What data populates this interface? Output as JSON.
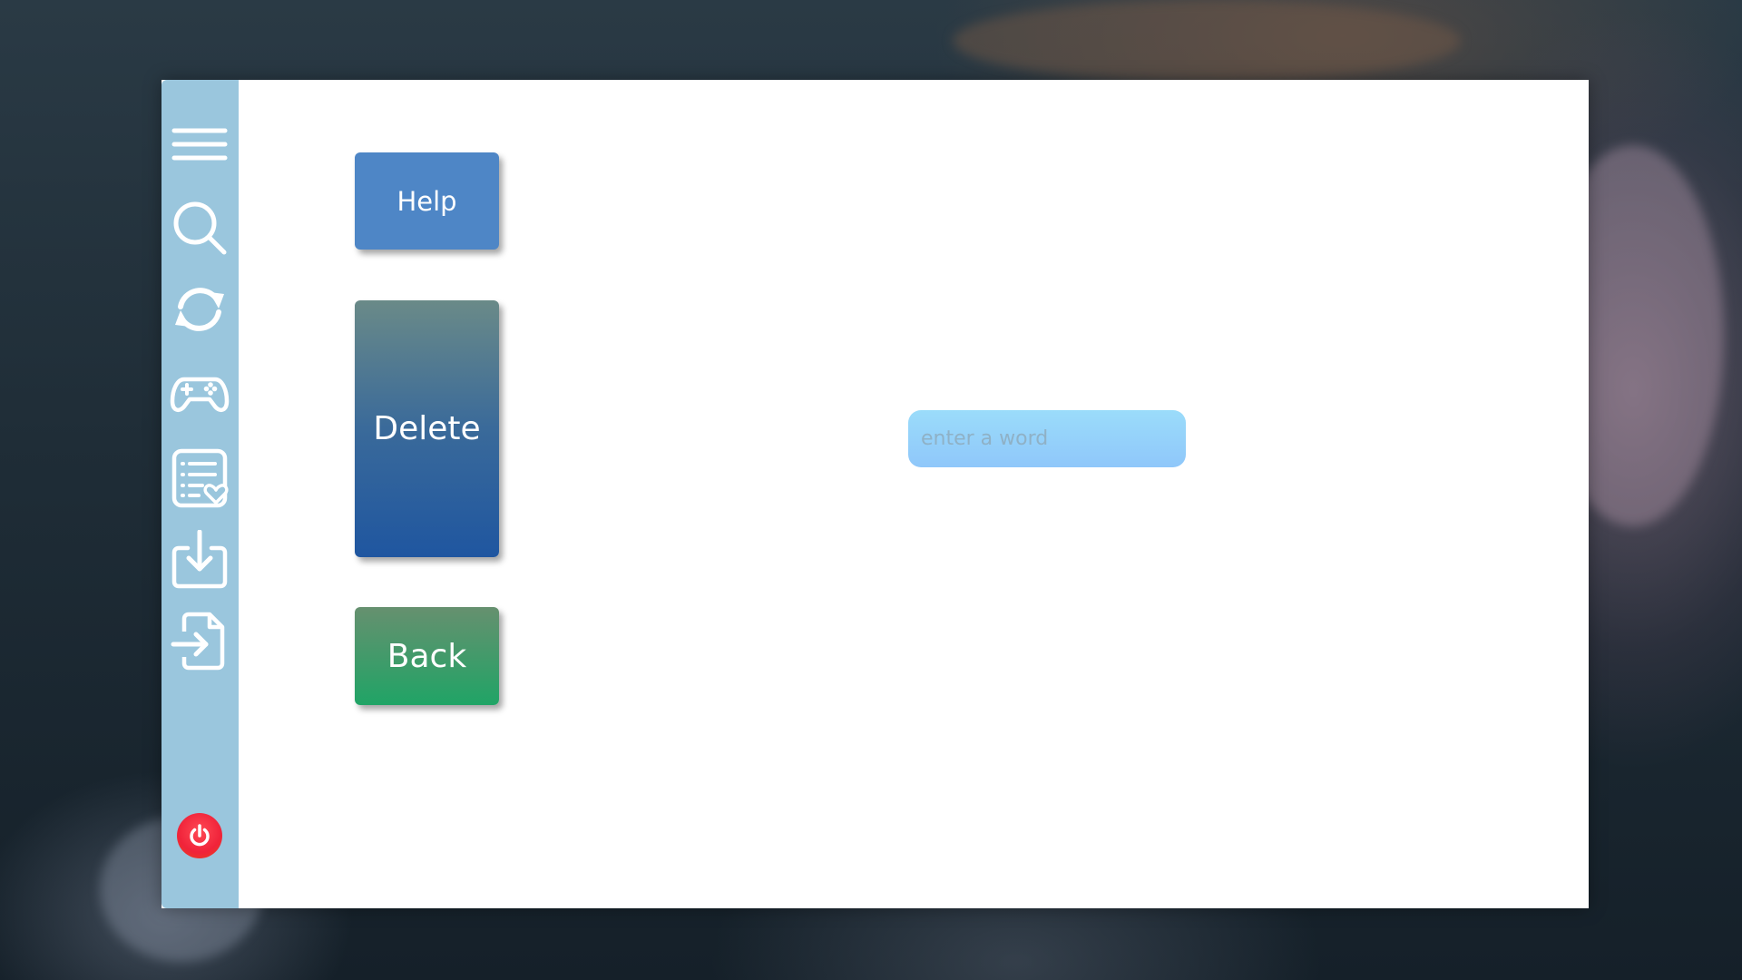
{
  "sidebar": {
    "items": [
      {
        "name": "menu",
        "icon": "hamburger-menu-icon"
      },
      {
        "name": "search",
        "icon": "search-icon"
      },
      {
        "name": "refresh",
        "icon": "refresh-icon"
      },
      {
        "name": "games",
        "icon": "gamepad-icon"
      },
      {
        "name": "favorites-list",
        "icon": "favorite-list-icon"
      },
      {
        "name": "download",
        "icon": "download-icon"
      },
      {
        "name": "import-file",
        "icon": "file-import-icon"
      }
    ],
    "power": {
      "icon": "power-icon",
      "color": "#f0233a"
    },
    "background_color": "#9ac6dd"
  },
  "buttons": {
    "help_label": "Help",
    "delete_label": "Delete",
    "back_label": "Back"
  },
  "search": {
    "value": "",
    "placeholder": "enter a word"
  },
  "colors": {
    "help": "#4e86c6",
    "delete": "#1f56a0",
    "back": "#20a466",
    "input": "#9bdcfa"
  }
}
